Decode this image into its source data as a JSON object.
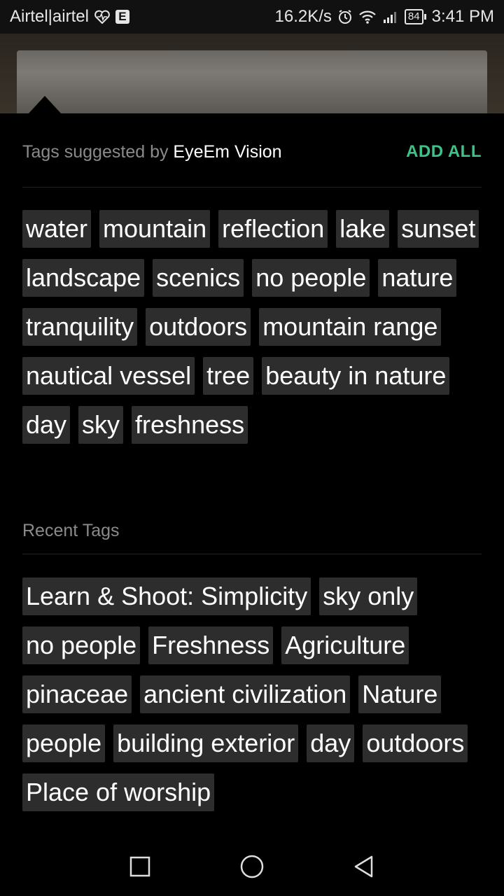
{
  "status_bar": {
    "carrier": "Airtel|airtel",
    "network_type": "E",
    "speed": "16.2K/s",
    "battery": "84",
    "time": "3:41 PM"
  },
  "suggested": {
    "title_prefix": "Tags suggested by ",
    "title_brand": "EyeEm Vision",
    "add_all_label": "ADD ALL",
    "tags": [
      "water",
      "mountain",
      "reflection",
      "lake",
      "sunset",
      "landscape",
      "scenics",
      "no people",
      "nature",
      "tranquility",
      "outdoors",
      "mountain range",
      "nautical vessel",
      "tree",
      "beauty in nature",
      "day",
      "sky",
      "freshness"
    ]
  },
  "recent": {
    "title": "Recent Tags",
    "tags": [
      "Learn & Shoot: Simplicity",
      "sky only",
      "no people",
      "Freshness",
      "Agriculture",
      "pinaceae",
      "ancient civilization",
      "Nature",
      "people",
      "building exterior",
      "day",
      "outdoors",
      "Place of worship"
    ]
  },
  "nav": {
    "icons": [
      "square-recent-icon",
      "circle-home-icon",
      "triangle-back-icon"
    ]
  },
  "colors": {
    "accent": "#3ec28a",
    "tag_bg": "#2d2d2d",
    "muted_text": "#8a8a8a"
  }
}
